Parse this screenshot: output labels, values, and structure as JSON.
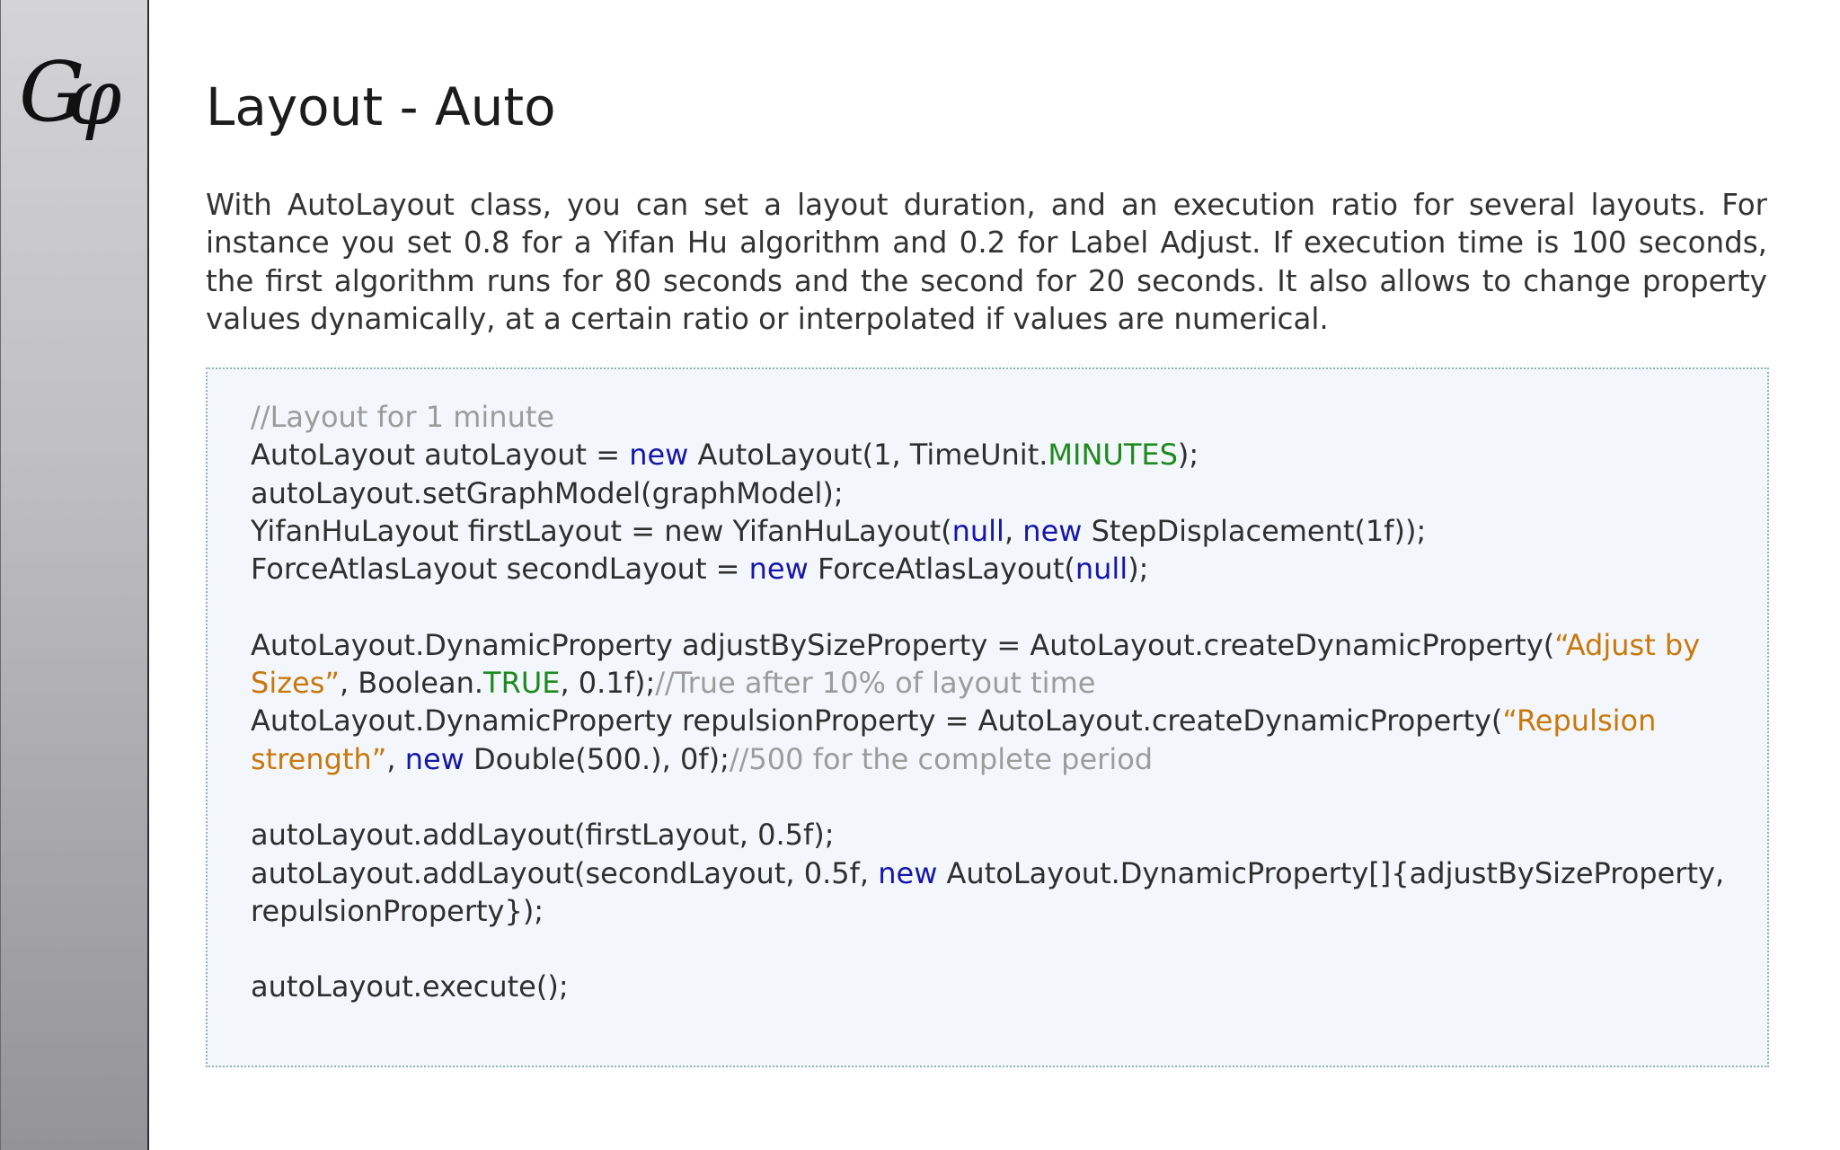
{
  "slide": {
    "title": "Layout - Auto",
    "description": "With AutoLayout class, you can set a layout duration, and an execution ratio for several layouts. For instance you set 0.8 for a Yifan Hu algorithm and 0.2 for Label Adjust. If execution time is 100 seconds, the first algorithm runs for 80 seconds and the second for 20 seconds. It also allows to change property values dynamically, at a certain ratio or interpolated if values are numerical."
  },
  "logo": {
    "text": "Gφ",
    "icon": "gephi-logo"
  },
  "colors": {
    "keyword": "#1616a8",
    "constant": "#1e8a1e",
    "string": "#c8780c",
    "comment": "#9c9c9c",
    "code_background": "#f3f7fb"
  },
  "code": {
    "lines": [
      [
        {
          "t": "//Layout for 1 minute",
          "c": "cmt"
        }
      ],
      [
        {
          "t": "AutoLayout autoLayout = "
        },
        {
          "t": "new",
          "c": "kw"
        },
        {
          "t": " AutoLayout(1, TimeUnit."
        },
        {
          "t": "MINUTES",
          "c": "const"
        },
        {
          "t": ");"
        }
      ],
      [
        {
          "t": "autoLayout.setGraphModel(graphModel);"
        }
      ],
      [
        {
          "t": "YifanHuLayout firstLayout = new YifanHuLayout("
        },
        {
          "t": "null",
          "c": "kw"
        },
        {
          "t": ", "
        },
        {
          "t": "new",
          "c": "kw"
        },
        {
          "t": " StepDisplacement(1f));"
        }
      ],
      [
        {
          "t": "ForceAtlasLayout secondLayout = "
        },
        {
          "t": "new",
          "c": "kw"
        },
        {
          "t": " ForceAtlasLayout("
        },
        {
          "t": "null",
          "c": "kw"
        },
        {
          "t": ");"
        }
      ],
      [],
      [
        {
          "t": "AutoLayout.DynamicProperty adjustBySizeProperty = AutoLayout.createDynamicProperty("
        },
        {
          "t": "“Adjust by",
          "c": "str"
        }
      ],
      [
        {
          "t": "Sizes”",
          "c": "str"
        },
        {
          "t": ", Boolean."
        },
        {
          "t": "TRUE",
          "c": "const"
        },
        {
          "t": ", 0.1f);"
        },
        {
          "t": "//True after 10% of layout time",
          "c": "cmt"
        }
      ],
      [
        {
          "t": "AutoLayout.DynamicProperty repulsionProperty = AutoLayout.createDynamicProperty("
        },
        {
          "t": "“Repulsion",
          "c": "str"
        }
      ],
      [
        {
          "t": "strength”",
          "c": "str"
        },
        {
          "t": ", "
        },
        {
          "t": "new",
          "c": "kw"
        },
        {
          "t": " Double(500.), 0f);"
        },
        {
          "t": "//500 for the complete period",
          "c": "cmt"
        }
      ],
      [],
      [
        {
          "t": "autoLayout.addLayout(firstLayout, 0.5f);"
        }
      ],
      [
        {
          "t": "autoLayout.addLayout(secondLayout, 0.5f, "
        },
        {
          "t": "new",
          "c": "kw"
        },
        {
          "t": " AutoLayout.DynamicProperty[]{adjustBySizeProperty,"
        }
      ],
      [
        {
          "t": "repulsionProperty});"
        }
      ],
      [],
      [
        {
          "t": "autoLayout.execute();"
        }
      ]
    ]
  }
}
